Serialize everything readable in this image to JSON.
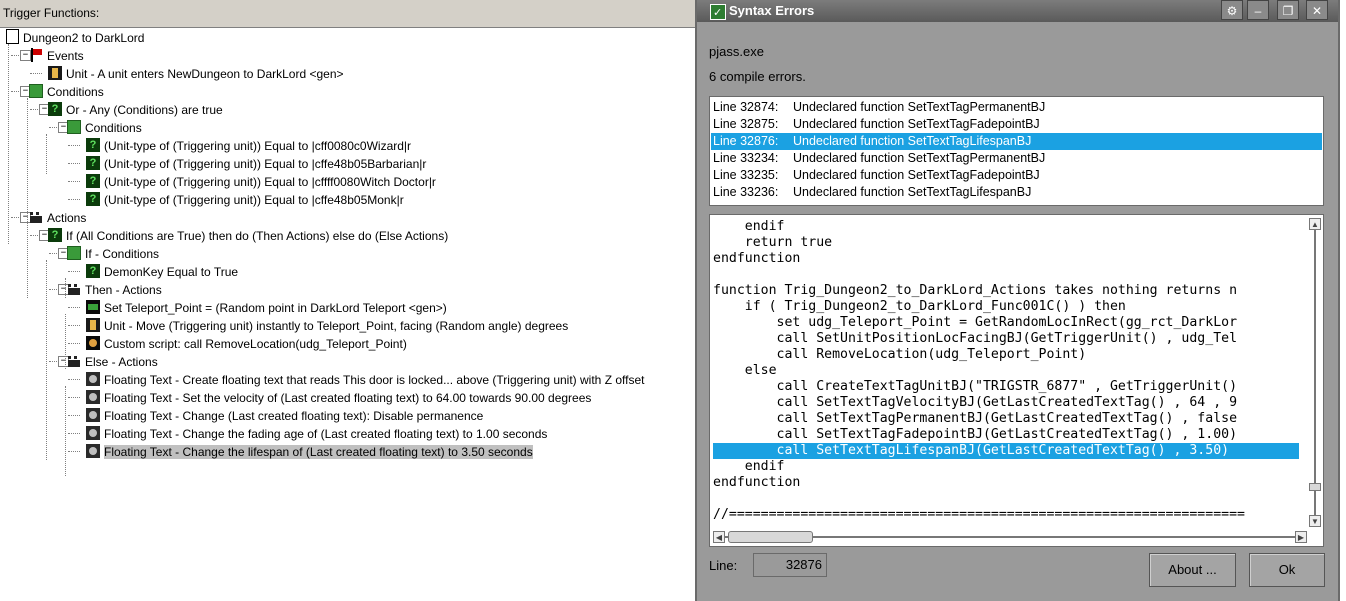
{
  "left": {
    "header": "Trigger Functions:",
    "tree": [
      {
        "label": "Dungeon2 to DarkLord",
        "icon": "document-icon"
      },
      {
        "label": "Events",
        "icon": "events-flag-icon"
      },
      {
        "label": "Unit - A unit enters NewDungeon to DarkLord <gen>",
        "icon": "unit-event-icon"
      },
      {
        "label": "Conditions",
        "icon": "conditions-icon"
      },
      {
        "label": "Or - Any (Conditions) are true",
        "icon": "condition-question-icon"
      },
      {
        "label": "Conditions",
        "icon": "conditions-icon"
      },
      {
        "label": "(Unit-type of (Triggering unit)) Equal to |cff0080c0Wizard|r",
        "icon": "condition-question-icon"
      },
      {
        "label": "(Unit-type of (Triggering unit)) Equal to |cffe48b05Barbarian|r",
        "icon": "condition-question-icon"
      },
      {
        "label": "(Unit-type of (Triggering unit)) Equal to |cffff0080Witch Doctor|r",
        "icon": "condition-question-icon"
      },
      {
        "label": "(Unit-type of (Triggering unit)) Equal to |cffe48b05Monk|r",
        "icon": "condition-question-icon"
      },
      {
        "label": "Actions",
        "icon": "actions-clapper-icon"
      },
      {
        "label": "If (All Conditions are True) then do (Then Actions) else do (Else Actions)",
        "icon": "condition-question-icon"
      },
      {
        "label": "If - Conditions",
        "icon": "conditions-icon"
      },
      {
        "label": "DemonKey Equal to True",
        "icon": "condition-question-icon"
      },
      {
        "label": "Then - Actions",
        "icon": "actions-clapper-icon"
      },
      {
        "label": "Set Teleport_Point = (Random point in DarkLord Teleport <gen>)",
        "icon": "set-variable-icon"
      },
      {
        "label": "Unit - Move (Triggering unit) instantly to Teleport_Point, facing (Random angle) degrees",
        "icon": "unit-action-icon"
      },
      {
        "label": "Custom script:   call RemoveLocation(udg_Teleport_Point)",
        "icon": "custom-script-icon"
      },
      {
        "label": "Else - Actions",
        "icon": "actions-clapper-icon"
      },
      {
        "label": "Floating Text - Create floating text that reads This door is locked... above (Triggering unit) with Z offset",
        "icon": "floating-text-icon"
      },
      {
        "label": "Floating Text - Set the velocity of (Last created floating text) to 64.00 towards 90.00 degrees",
        "icon": "floating-text-icon"
      },
      {
        "label": "Floating Text - Change (Last created floating text): Disable permanence",
        "icon": "floating-text-icon"
      },
      {
        "label": "Floating Text - Change the fading age of (Last created floating text) to 1.00 seconds",
        "icon": "floating-text-icon"
      },
      {
        "label": "Floating Text - Change the lifespan of (Last created floating text) to 3.50 seconds",
        "icon": "floating-text-icon"
      }
    ]
  },
  "dialog": {
    "title": "Syntax Errors",
    "exe": "pjass.exe",
    "error_count": "6 compile errors.",
    "errors": [
      {
        "line": "Line 32874:",
        "msg": "Undeclared function SetTextTagPermanentBJ"
      },
      {
        "line": "Line 32875:",
        "msg": "Undeclared function SetTextTagFadepointBJ"
      },
      {
        "line": "Line 32876:",
        "msg": "Undeclared function SetTextTagLifespanBJ"
      },
      {
        "line": "Line 33234:",
        "msg": "Undeclared function SetTextTagPermanentBJ"
      },
      {
        "line": "Line 33235:",
        "msg": "Undeclared function SetTextTagFadepointBJ"
      },
      {
        "line": "Line 33236:",
        "msg": "Undeclared function SetTextTagLifespanBJ"
      }
    ],
    "selected_error_index": 2,
    "code_lines": [
      "    endif",
      "    return true",
      "endfunction",
      "",
      "function Trig_Dungeon2_to_DarkLord_Actions takes nothing returns n",
      "    if ( Trig_Dungeon2_to_DarkLord_Func001C() ) then",
      "        set udg_Teleport_Point = GetRandomLocInRect(gg_rct_DarkLor",
      "        call SetUnitPositionLocFacingBJ(GetTriggerUnit() , udg_Tel",
      "        call RemoveLocation(udg_Teleport_Point)",
      "    else",
      "        call CreateTextTagUnitBJ(\"TRIGSTR_6877\" , GetTriggerUnit()",
      "        call SetTextTagVelocityBJ(GetLastCreatedTextTag() , 64 , 9",
      "        call SetTextTagPermanentBJ(GetLastCreatedTextTag() , false",
      "        call SetTextTagFadepointBJ(GetLastCreatedTextTag() , 1.00)",
      "        call SetTextTagLifespanBJ(GetLastCreatedTextTag() , 3.50)",
      "    endif",
      "endfunction",
      "",
      "//================================================================="
    ],
    "highlighted_code_index": 14,
    "line_label": "Line:",
    "line_value": "32876",
    "about_label": "About ...",
    "ok_label": "Ok",
    "title_buttons": {
      "config": "⚙",
      "minimize": "–",
      "maximize": "❐",
      "close": "✕"
    },
    "colors": {
      "selection": "#1ba1e2",
      "dialog_bg": "#9a9a9a"
    }
  }
}
